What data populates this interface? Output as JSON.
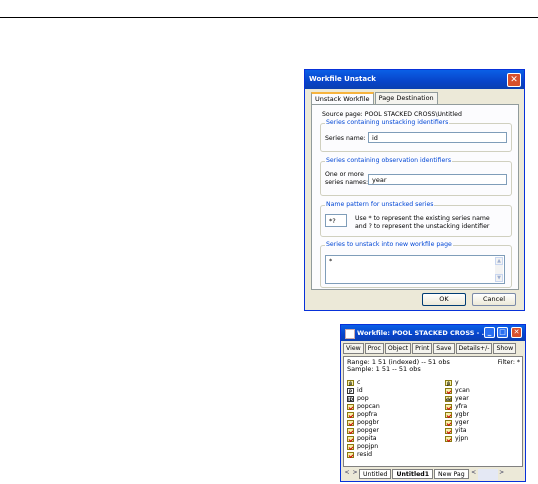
{
  "dialog": {
    "title": "Workfile Unstack",
    "tabs": [
      "Unstack Workfile",
      "Page Destination"
    ],
    "source_page": "Source page: POOL STACKED CROSS\\Untitled",
    "group1": {
      "label": "Series containing unstacking identifiers",
      "field_label": "Series name:",
      "value": "id"
    },
    "group2": {
      "label": "Series containing observation identifiers",
      "field_label_1": "One or more",
      "field_label_2": "series names:",
      "value": "year"
    },
    "group3": {
      "label": "Name pattern for unstacked series",
      "value": "*?",
      "help_1": "Use * to represent the existing series name",
      "help_2": "and ? to represent the unstacking identifier"
    },
    "group4": {
      "label": "Series to unstack into new workfile page",
      "value": "*"
    },
    "ok": "OK",
    "cancel": "Cancel"
  },
  "workfile": {
    "title": "Workfile: POOL STACKED CROSS - ...",
    "toolbar": [
      "View",
      "Proc",
      "Object",
      "Print",
      "Save",
      "Details+/-",
      "Show"
    ],
    "range": "Range:  1 51 (indexed)  --  51 obs",
    "sample": "Sample: 1 51  --  51 obs",
    "filter": "Filter: *",
    "objects_left": [
      {
        "icon": "coef",
        "name": "c"
      },
      {
        "icon": "id",
        "name": "id"
      },
      {
        "icon": "pop-id",
        "name": "pop"
      },
      {
        "icon": "series",
        "name": "popcan"
      },
      {
        "icon": "series",
        "name": "popfra"
      },
      {
        "icon": "series",
        "name": "popgbr"
      },
      {
        "icon": "series",
        "name": "popger"
      },
      {
        "icon": "series",
        "name": "popita"
      },
      {
        "icon": "series",
        "name": "popjpn"
      },
      {
        "icon": "series",
        "name": "resid"
      }
    ],
    "objects_right": [
      {
        "icon": "coef",
        "name": "y"
      },
      {
        "icon": "series",
        "name": "ycan"
      },
      {
        "icon": "date",
        "name": "year"
      },
      {
        "icon": "series",
        "name": "yfra"
      },
      {
        "icon": "series",
        "name": "ygbr"
      },
      {
        "icon": "series",
        "name": "yger"
      },
      {
        "icon": "series",
        "name": "yita"
      },
      {
        "icon": "series",
        "name": "yjpn"
      }
    ],
    "page_tabs": [
      "Untitled",
      "Untitled1",
      "New Pag"
    ]
  }
}
